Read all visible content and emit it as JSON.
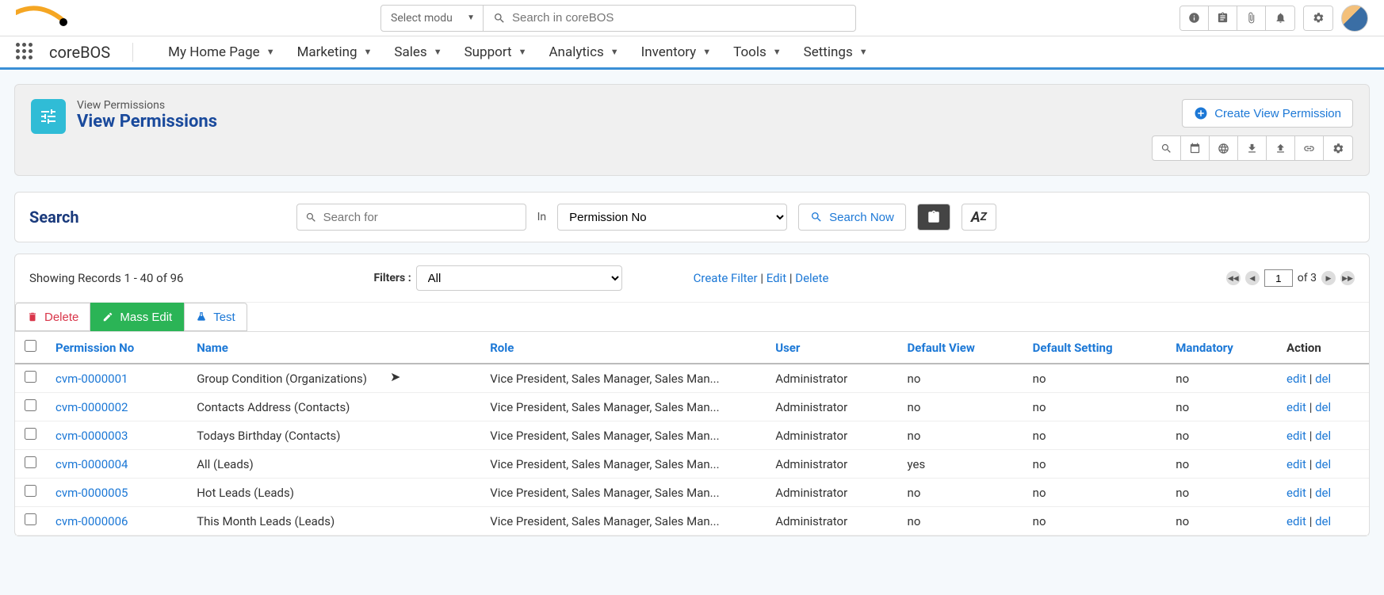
{
  "topbar": {
    "module_select_placeholder": "Select modu",
    "search_placeholder": "Search in coreBOS"
  },
  "nav": {
    "brand": "coreBOS",
    "items": [
      "My Home Page",
      "Marketing",
      "Sales",
      "Support",
      "Analytics",
      "Inventory",
      "Tools",
      "Settings"
    ]
  },
  "page": {
    "crumb": "View Permissions",
    "title": "View Permissions",
    "create_label": "Create View Permission"
  },
  "search": {
    "heading": "Search",
    "placeholder": "Search for",
    "in_label": "In",
    "field_selected": "Permission No",
    "button": "Search Now"
  },
  "filters": {
    "records_info": "Showing Records 1 - 40 of 96",
    "label": "Filters :",
    "selected": "All",
    "create": "Create Filter",
    "edit": "Edit",
    "delete": "Delete",
    "page_value": "1",
    "page_of": "of 3"
  },
  "actions": {
    "delete": "Delete",
    "mass_edit": "Mass Edit",
    "test": "Test"
  },
  "table": {
    "headers": {
      "permission_no": "Permission No",
      "name": "Name",
      "role": "Role",
      "user": "User",
      "default_view": "Default View",
      "default_setting": "Default Setting",
      "mandatory": "Mandatory",
      "action": "Action"
    },
    "action_edit": "edit",
    "action_del": "del",
    "rows": [
      {
        "pno": "cvm-0000001",
        "name": "Group Condition (Organizations)",
        "role": "Vice President, Sales Manager, Sales Man...",
        "user": "Administrator",
        "dview": "no",
        "dset": "no",
        "mand": "no"
      },
      {
        "pno": "cvm-0000002",
        "name": "Contacts Address (Contacts)",
        "role": "Vice President, Sales Manager, Sales Man...",
        "user": "Administrator",
        "dview": "no",
        "dset": "no",
        "mand": "no"
      },
      {
        "pno": "cvm-0000003",
        "name": "Todays Birthday (Contacts)",
        "role": "Vice President, Sales Manager, Sales Man...",
        "user": "Administrator",
        "dview": "no",
        "dset": "no",
        "mand": "no"
      },
      {
        "pno": "cvm-0000004",
        "name": "All (Leads)",
        "role": "Vice President, Sales Manager, Sales Man...",
        "user": "Administrator",
        "dview": "yes",
        "dset": "no",
        "mand": "no"
      },
      {
        "pno": "cvm-0000005",
        "name": "Hot Leads (Leads)",
        "role": "Vice President, Sales Manager, Sales Man...",
        "user": "Administrator",
        "dview": "no",
        "dset": "no",
        "mand": "no"
      },
      {
        "pno": "cvm-0000006",
        "name": "This Month Leads (Leads)",
        "role": "Vice President, Sales Manager, Sales Man...",
        "user": "Administrator",
        "dview": "no",
        "dset": "no",
        "mand": "no"
      }
    ]
  }
}
